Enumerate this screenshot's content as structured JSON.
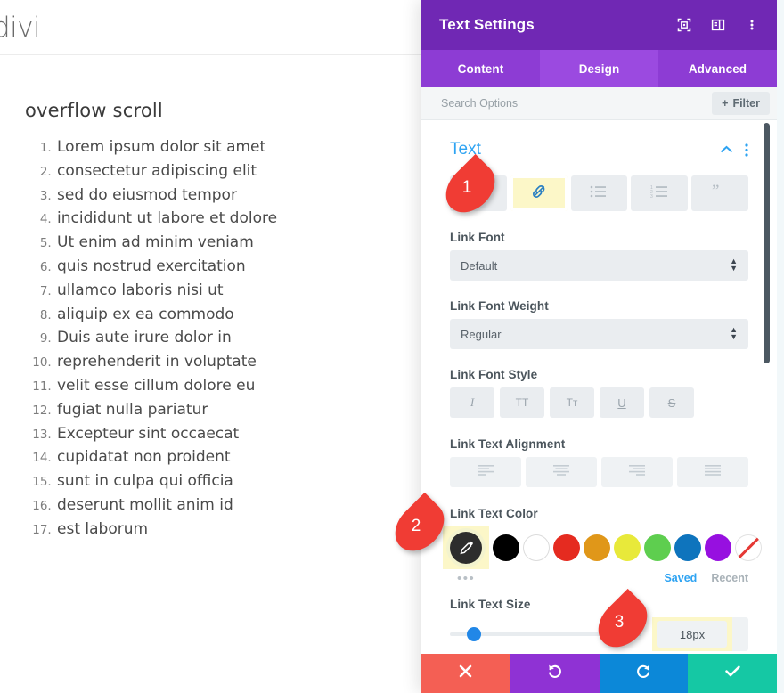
{
  "site": {
    "logo": "divi",
    "content_title": "overflow scroll",
    "list_items": [
      "Lorem ipsum dolor sit amet",
      "consectetur adipiscing elit",
      "sed do eiusmod tempor",
      "incididunt ut labore et dolore",
      "Ut enim ad minim veniam",
      "quis nostrud exercitation",
      "ullamco laboris nisi ut",
      "aliquip ex ea commodo",
      "Duis aute irure dolor in",
      "reprehenderit in voluptate",
      "velit esse cillum dolore eu",
      "fugiat nulla pariatur",
      "Excepteur sint occaecat",
      "cupidatat non proident",
      "sunt in culpa qui officia",
      "deserunt mollit anim id",
      "est laborum"
    ]
  },
  "modal": {
    "title": "Text Settings",
    "header_icons": [
      "focus-target-icon",
      "panel-layout-icon",
      "kebab-menu-icon"
    ],
    "tabs": [
      {
        "label": "Content",
        "active": false
      },
      {
        "label": "Design",
        "active": true
      },
      {
        "label": "Advanced",
        "active": false
      }
    ],
    "search": {
      "placeholder": "Search Options",
      "value": "",
      "filter_label": "Filter",
      "filter_icon": "plus-icon"
    },
    "section": {
      "title": "Text",
      "collapse_icon": "chevron-up-icon",
      "menu_icon": "kebab-menu-icon"
    },
    "text_type_buttons": [
      {
        "name": "paragraph-text-button",
        "icon": "paragraph-icon",
        "highlighted": false
      },
      {
        "name": "link-text-button",
        "icon": "link-icon",
        "highlighted": true
      },
      {
        "name": "unordered-list-button",
        "icon": "unordered-list-icon",
        "highlighted": false
      },
      {
        "name": "ordered-list-button",
        "icon": "ordered-list-icon",
        "highlighted": false
      },
      {
        "name": "blockquote-button",
        "icon": "quote-icon",
        "highlighted": false
      }
    ],
    "fields": {
      "link_font": {
        "label": "Link Font",
        "value": "Default"
      },
      "link_font_weight": {
        "label": "Link Font Weight",
        "value": "Regular"
      },
      "link_font_style": {
        "label": "Link Font Style",
        "buttons": [
          {
            "name": "italic-button",
            "glyph": "I"
          },
          {
            "name": "uppercase-button",
            "glyph": "TT"
          },
          {
            "name": "smallcaps-button",
            "glyph": "Tᴛ"
          },
          {
            "name": "underline-button",
            "glyph": "U"
          },
          {
            "name": "strikethrough-button",
            "glyph": "S"
          }
        ]
      },
      "link_text_alignment": {
        "label": "Link Text Alignment",
        "buttons": [
          {
            "name": "align-left-button",
            "icon": "align-left-icon"
          },
          {
            "name": "align-center-button",
            "icon": "align-center-icon"
          },
          {
            "name": "align-right-button",
            "icon": "align-right-icon"
          },
          {
            "name": "align-justify-button",
            "icon": "align-justify-icon"
          }
        ]
      },
      "link_text_color": {
        "label": "Link Text Color",
        "eyedropper_icon": "eyedropper-icon",
        "swatches": [
          {
            "name": "swatch-black",
            "color": "#000000"
          },
          {
            "name": "swatch-white",
            "color": "#ffffff"
          },
          {
            "name": "swatch-red",
            "color": "#e52b20"
          },
          {
            "name": "swatch-orange",
            "color": "#e09719"
          },
          {
            "name": "swatch-yellow",
            "color": "#e8e93a"
          },
          {
            "name": "swatch-green",
            "color": "#5ece4f"
          },
          {
            "name": "swatch-blue",
            "color": "#0e74bd"
          },
          {
            "name": "swatch-purple",
            "color": "#9710e0"
          },
          {
            "name": "swatch-transparent",
            "color": "transparent"
          }
        ],
        "more_label": "•••",
        "saved_label": "Saved",
        "recent_label": "Recent"
      },
      "link_text_size": {
        "label": "Link Text Size",
        "value": "18px",
        "slider_percent": 12.5
      }
    },
    "footer": [
      {
        "name": "cancel-button",
        "icon": "x-icon",
        "color": "#f45f54"
      },
      {
        "name": "undo-button",
        "icon": "undo-icon",
        "color": "#8f32d4"
      },
      {
        "name": "redo-button",
        "icon": "redo-icon",
        "color": "#0c88d8"
      },
      {
        "name": "save-button",
        "icon": "check-icon",
        "color": "#15c8a4"
      }
    ]
  },
  "markers": [
    {
      "label": "1"
    },
    {
      "label": "2"
    },
    {
      "label": "3"
    }
  ],
  "colors": {
    "header_purple": "#7028b4",
    "tab_purple": "#8d3cd4",
    "tab_active_purple": "#9b4ae0",
    "accent_blue": "#2ea3f2",
    "highlight_yellow": "#fcf7c8",
    "marker_red": "#f03c34"
  }
}
